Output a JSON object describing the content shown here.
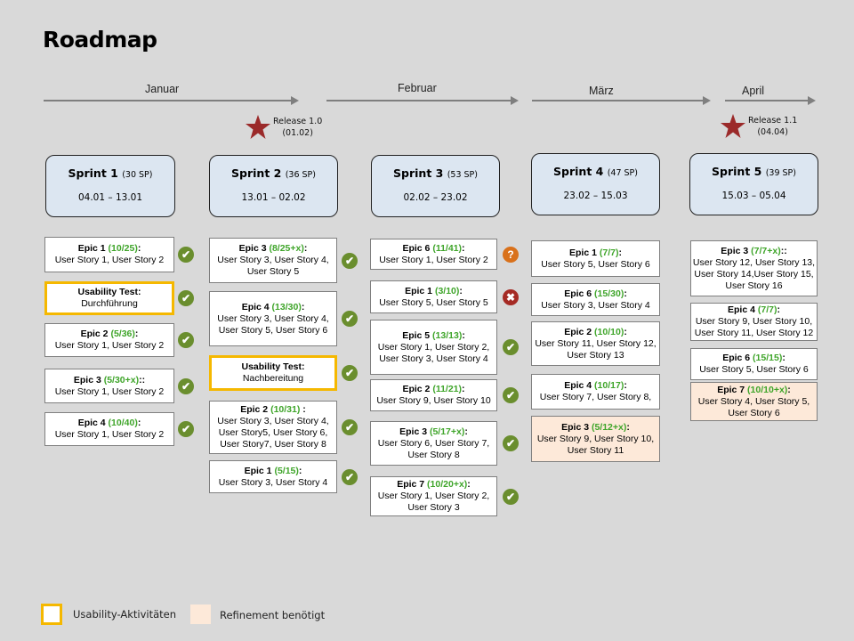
{
  "title": "Roadmap",
  "months": [
    "Januar",
    "Februar",
    "März",
    "April"
  ],
  "releases": [
    {
      "name": "Release 1.0",
      "date": "(01.02)"
    },
    {
      "name": "Release 1.1",
      "date": "(04.04)"
    }
  ],
  "colors": {
    "background": "#d9d9d9",
    "sprint_fill": "#dce6f1",
    "usability_border": "#f5b800",
    "refinement_fill": "#fde9d9",
    "progress_text": "#3fa52a",
    "status_done": "#6a8e2e",
    "status_unknown": "#d9711b",
    "status_failed": "#a52a24",
    "release_star": "#9b2a2a"
  },
  "sprints": [
    {
      "name": "Sprint 1",
      "sp": "(30 SP)",
      "dates": "04.01 – 13.01",
      "items": [
        {
          "head": "Epic 1",
          "progress": "(10/25)",
          "suffix": ":",
          "stories": "User Story 1, User Story 2",
          "type": "epic",
          "status": "done"
        },
        {
          "head": "Usability Test:",
          "progress": "",
          "suffix": "",
          "stories": "Durchführung",
          "type": "usability",
          "status": "done"
        },
        {
          "head": "Epic 2",
          "progress": "(5/36)",
          "suffix": ":",
          "stories": "User Story 1, User Story 2",
          "type": "epic",
          "status": "done"
        },
        {
          "head": "Epic 3",
          "progress": "(5/30+x)",
          "suffix": "::",
          "stories": "User Story 1, User Story 2",
          "type": "epic",
          "status": "done"
        },
        {
          "head": "Epic 4",
          "progress": "(10/40)",
          "suffix": ":",
          "stories": "User Story 1, User Story 2",
          "type": "epic",
          "status": "done"
        }
      ]
    },
    {
      "name": "Sprint 2",
      "sp": "(36 SP)",
      "dates": "13.01 – 02.02",
      "items": [
        {
          "head": "Epic 3",
          "progress": "(8/25+x)",
          "suffix": ":",
          "stories": "User Story 3, User Story 4, User Story 5",
          "type": "epic",
          "status": "done"
        },
        {
          "head": "Epic 4",
          "progress": "(13/30)",
          "suffix": ":",
          "stories": "User Story 3, User Story 4, User Story 5, User Story 6",
          "type": "epic",
          "status": "done"
        },
        {
          "head": "Usability Test:",
          "progress": "",
          "suffix": "",
          "stories": "Nachbereitung",
          "type": "usability",
          "status": "done"
        },
        {
          "head": "Epic 2",
          "progress": "(10/31)",
          "suffix": " :",
          "stories": "User Story 3, User Story 4, User Story5, User Story 6, User Story7, User Story 8",
          "type": "epic",
          "status": "done"
        },
        {
          "head": "Epic 1",
          "progress": "(5/15)",
          "suffix": ":",
          "stories": "User Story 3, User Story 4",
          "type": "epic",
          "status": "done"
        }
      ]
    },
    {
      "name": "Sprint 3",
      "sp": "(53 SP)",
      "dates": "02.02 – 23.02",
      "items": [
        {
          "head": "Epic 6",
          "progress": "(11/41)",
          "suffix": ":",
          "stories": "User Story 1, User Story 2",
          "type": "epic",
          "status": "unknown"
        },
        {
          "head": "Epic 1",
          "progress": "(3/10)",
          "suffix": ":",
          "stories": "User Story 5, User Story 5",
          "type": "epic",
          "status": "failed"
        },
        {
          "head": "Epic 5",
          "progress": "(13/13)",
          "suffix": ":",
          "stories": "User Story 1, User Story 2, User Story 3, User Story 4",
          "type": "epic",
          "status": "done"
        },
        {
          "head": "Epic 2",
          "progress": "(11/21)",
          "suffix": ":",
          "stories": "User Story 9, User Story 10",
          "type": "epic",
          "status": "done"
        },
        {
          "head": "Epic 3",
          "progress": "(5/17+x)",
          "suffix": ":",
          "stories": "User Story 6, User Story 7, User Story 8",
          "type": "epic",
          "status": "done"
        },
        {
          "head": "Epic 7",
          "progress": "(10/20+x)",
          "suffix": ":",
          "stories": "User Story 1, User Story 2, User Story 3",
          "type": "epic",
          "status": "done"
        }
      ]
    },
    {
      "name": "Sprint 4",
      "sp": "(47 SP)",
      "dates": "23.02 – 15.03",
      "items": [
        {
          "head": "Epic 1",
          "progress": "(7/7)",
          "suffix": ":",
          "stories": "User Story 5, User Story 6",
          "type": "epic",
          "status": "none"
        },
        {
          "head": "Epic 6",
          "progress": "(15/30)",
          "suffix": ":",
          "stories": "User Story 3, User Story 4",
          "type": "epic",
          "status": "none"
        },
        {
          "head": "Epic 2",
          "progress": "(10/10)",
          "suffix": ":",
          "stories": "User Story 11, User Story 12, User Story 13",
          "type": "epic",
          "status": "none"
        },
        {
          "head": "Epic 4",
          "progress": "(10/17)",
          "suffix": ":",
          "stories": "User Story 7, User Story 8,",
          "type": "epic",
          "status": "none"
        },
        {
          "head": "Epic 3",
          "progress": "(5/12+x)",
          "suffix": ":",
          "stories": "User Story 9, User Story 10, User Story 11",
          "type": "refinement",
          "status": "none"
        }
      ]
    },
    {
      "name": "Sprint 5",
      "sp": "(39 SP)",
      "dates": "15.03 – 05.04",
      "items": [
        {
          "head": "Epic 3",
          "progress": "(7/7+x)",
          "suffix": "::",
          "stories": "User Story 12, User Story 13, User Story 14,User Story 15, User Story 16",
          "type": "epic",
          "status": "none"
        },
        {
          "head": "Epic 4",
          "progress": "(7/7)",
          "suffix": ":",
          "stories": "User Story 9, User Story 10, User Story 11, User Story 12",
          "type": "epic",
          "status": "none"
        },
        {
          "head": "Epic 6",
          "progress": "(15/15)",
          "suffix": ":",
          "stories": "User Story 5, User Story 6",
          "type": "epic",
          "status": "none"
        },
        {
          "head": "Epic 7",
          "progress": "(10/10+x)",
          "suffix": ":",
          "stories": "User Story 4, User Story 5, User Story 6",
          "type": "refinement",
          "status": "none"
        }
      ]
    }
  ],
  "legend": {
    "usability": "Usability-Aktivitäten",
    "refinement": "Refinement benötigt"
  }
}
